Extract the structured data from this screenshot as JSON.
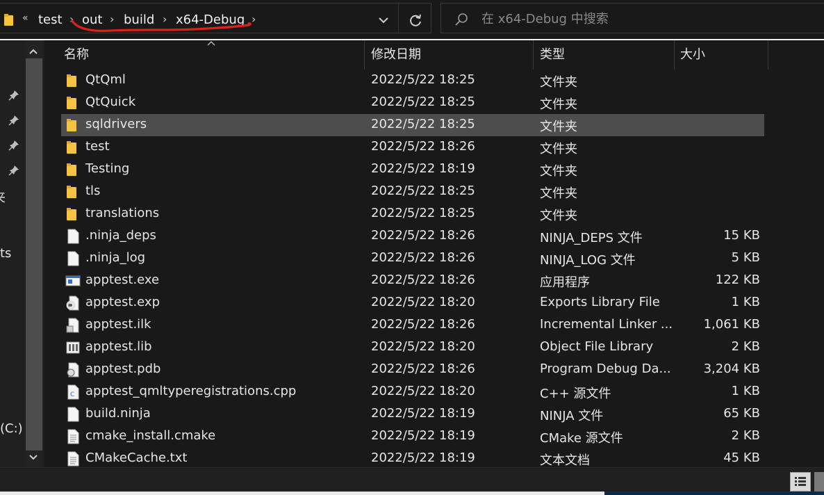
{
  "address_bar": {
    "overflow_glyph": "«",
    "breadcrumbs": [
      "test",
      "out",
      "build",
      "x64-Debug"
    ],
    "separator": "›"
  },
  "search": {
    "placeholder": "在 x64-Debug 中搜索"
  },
  "nav_pane": {
    "partial_labels": [
      "夹",
      "ts",
      "(C:)"
    ],
    "pinned_count": 4
  },
  "columns": {
    "name": "名称",
    "date": "修改日期",
    "type": "类型",
    "size": "大小"
  },
  "files": [
    {
      "name": "QtQml",
      "date": "2022/5/22 18:25",
      "type": "文件夹",
      "size": "",
      "icon": "folder-icon"
    },
    {
      "name": "QtQuick",
      "date": "2022/5/22 18:25",
      "type": "文件夹",
      "size": "",
      "icon": "folder-icon"
    },
    {
      "name": "sqldrivers",
      "date": "2022/5/22 18:25",
      "type": "文件夹",
      "size": "",
      "icon": "folder-icon",
      "selected": true
    },
    {
      "name": "test",
      "date": "2022/5/22 18:26",
      "type": "文件夹",
      "size": "",
      "icon": "folder-icon"
    },
    {
      "name": "Testing",
      "date": "2022/5/22 18:19",
      "type": "文件夹",
      "size": "",
      "icon": "folder-icon"
    },
    {
      "name": "tls",
      "date": "2022/5/22 18:25",
      "type": "文件夹",
      "size": "",
      "icon": "folder-icon"
    },
    {
      "name": "translations",
      "date": "2022/5/22 18:25",
      "type": "文件夹",
      "size": "",
      "icon": "folder-icon"
    },
    {
      "name": ".ninja_deps",
      "date": "2022/5/22 18:26",
      "type": "NINJA_DEPS 文件",
      "size": "15 KB",
      "icon": "blank-file-icon"
    },
    {
      "name": ".ninja_log",
      "date": "2022/5/22 18:26",
      "type": "NINJA_LOG 文件",
      "size": "5 KB",
      "icon": "blank-file-icon"
    },
    {
      "name": "apptest.exe",
      "date": "2022/5/22 18:26",
      "type": "应用程序",
      "size": "122 KB",
      "icon": "exe-icon"
    },
    {
      "name": "apptest.exp",
      "date": "2022/5/22 18:20",
      "type": "Exports Library File",
      "size": "1 KB",
      "icon": "gear-file-icon"
    },
    {
      "name": "apptest.ilk",
      "date": "2022/5/22 18:26",
      "type": "Incremental Linker ...",
      "size": "1,061 KB",
      "icon": "linker-file-icon"
    },
    {
      "name": "apptest.lib",
      "date": "2022/5/22 18:20",
      "type": "Object File Library",
      "size": "2 KB",
      "icon": "library-file-icon"
    },
    {
      "name": "apptest.pdb",
      "date": "2022/5/22 18:26",
      "type": "Program Debug Da...",
      "size": "3,204 KB",
      "icon": "debug-file-icon"
    },
    {
      "name": "apptest_qmltyperegistrations.cpp",
      "date": "2022/5/22 18:20",
      "type": "C++ 源文件",
      "size": "1 KB",
      "icon": "cpp-file-icon"
    },
    {
      "name": "build.ninja",
      "date": "2022/5/22 18:19",
      "type": "NINJA 文件",
      "size": "65 KB",
      "icon": "blank-file-icon"
    },
    {
      "name": "cmake_install.cmake",
      "date": "2022/5/22 18:19",
      "type": "CMake 源文件",
      "size": "2 KB",
      "icon": "text-file-icon"
    },
    {
      "name": "CMakeCache.txt",
      "date": "2022/5/22 18:19",
      "type": "文本文档",
      "size": "45 KB",
      "icon": "text-file-icon"
    }
  ],
  "colors": {
    "background": "#191919",
    "selection": "#4d4d4d",
    "folder": "#f5c342",
    "annotation": "#e0201a"
  }
}
